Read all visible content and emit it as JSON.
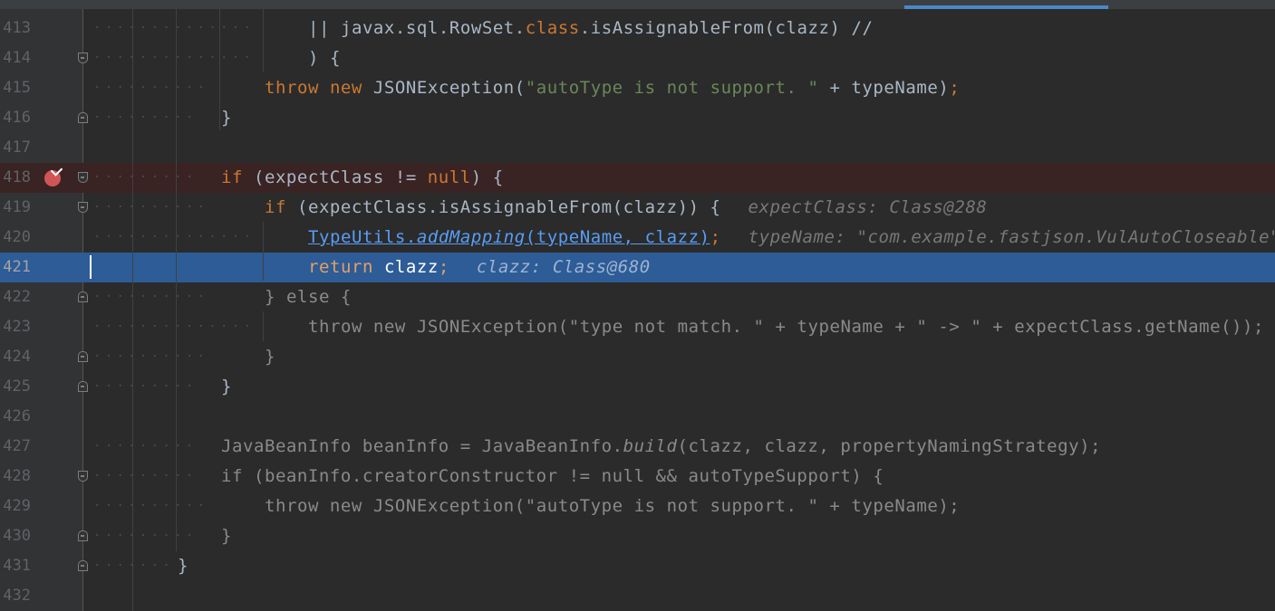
{
  "window": {
    "active_tab_accent": "#4a88c7"
  },
  "editor": {
    "colors": {
      "background": "#2b2b2b",
      "gutter": "#313335",
      "keyword": "#cc7832",
      "string": "#6a8759",
      "text": "#a9b7c6",
      "link": "#589df6",
      "execution_line": "#2d5c97",
      "breakpoint_line": "#3a2323",
      "breakpoint": "#d05555"
    },
    "breakpoint_icon": "breakpoint-check-icon",
    "fold_icon": "fold-marker-icon",
    "lines": [
      {
        "num": "413",
        "t": [
          "|| ",
          "javax.sql.RowSet.",
          "class",
          ".isAssignableFrom(clazz) //"
        ]
      },
      {
        "num": "414",
        "t": [
          ") {"
        ]
      },
      {
        "num": "415",
        "t": [
          "throw ",
          "new ",
          "JSONException(",
          "\"autoType is not support. \"",
          " + typeName)",
          ";"
        ]
      },
      {
        "num": "416",
        "t": [
          "}"
        ]
      },
      {
        "num": "417",
        "t": [
          ""
        ]
      },
      {
        "num": "418",
        "t": [
          "if ",
          "(expectClass != ",
          "null",
          ") {"
        ]
      },
      {
        "num": "419",
        "t": [
          "if ",
          "(expectClass.isAssignableFrom(clazz)) {"
        ],
        "hint": "expectClass: Class@288"
      },
      {
        "num": "420",
        "t": [
          "TypeUtils.",
          "addMapping",
          "(typeName, clazz)",
          ";"
        ],
        "hint": "typeName: \"com.example.fastjson.VulAutoCloseable\""
      },
      {
        "num": "421",
        "t": [
          "return ",
          "clazz",
          ";"
        ],
        "hint": "clazz: Class@680"
      },
      {
        "num": "422",
        "t": [
          "} else {"
        ]
      },
      {
        "num": "423",
        "t": [
          "throw new JSONException(\"type not match. \" + typeName + \" -> \" + expectClass.getName());"
        ]
      },
      {
        "num": "424",
        "t": [
          "}"
        ]
      },
      {
        "num": "425",
        "t": [
          "}"
        ]
      },
      {
        "num": "426",
        "t": [
          ""
        ]
      },
      {
        "num": "427",
        "t": [
          "JavaBeanInfo beanInfo = JavaBeanInfo.",
          "build",
          "(clazz, clazz, propertyNamingStrategy);"
        ]
      },
      {
        "num": "428",
        "t": [
          "if (beanInfo.creatorConstructor != null && autoTypeSupport) {"
        ]
      },
      {
        "num": "429",
        "t": [
          "throw new JSONException(\"autoType is not support. \" + typeName);"
        ]
      },
      {
        "num": "430",
        "t": [
          "}"
        ]
      },
      {
        "num": "431",
        "t": [
          "}"
        ]
      },
      {
        "num": "432",
        "t": [
          ""
        ]
      }
    ]
  }
}
